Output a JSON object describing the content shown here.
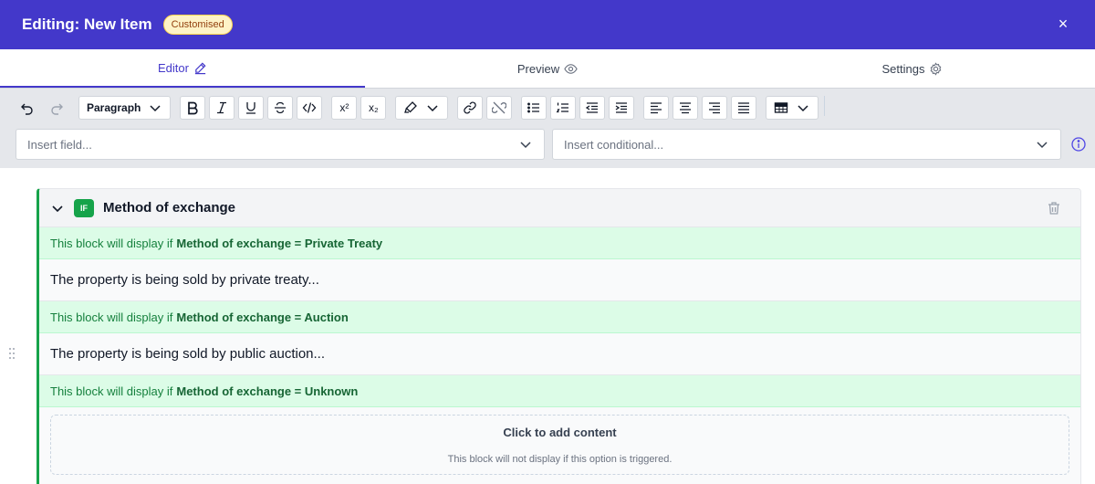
{
  "header": {
    "title": "Editing: New Item",
    "badge": "Customised",
    "close_label": "×"
  },
  "tabs": [
    {
      "label": "Editor",
      "icon": "pencil-icon",
      "active": true
    },
    {
      "label": "Preview",
      "icon": "eye-icon",
      "active": false
    },
    {
      "label": "Settings",
      "icon": "gear-icon",
      "active": false
    }
  ],
  "toolbar": {
    "paragraph_label": "Paragraph",
    "superscript_label": "x²",
    "subscript_label": "x₂",
    "insert_field_placeholder": "Insert field...",
    "insert_conditional_placeholder": "Insert conditional..."
  },
  "block": {
    "tag": "IF",
    "title": "Method of exchange",
    "conditions": [
      {
        "prefix": "This block will display if",
        "rule": "Method of exchange = Private Treaty",
        "content": "The property is being sold by private treaty..."
      },
      {
        "prefix": "This block will display if",
        "rule": "Method of exchange = Auction",
        "content": "The property is being sold by public auction..."
      },
      {
        "prefix": "This block will display if",
        "rule": "Method of exchange = Unknown",
        "add_title": "Click to add content",
        "add_subtitle": "This block will not display if this option is triggered."
      }
    ]
  },
  "colors": {
    "header_bg": "#4338ca",
    "accent": "#4338ca",
    "condition_bg": "#dcfce7",
    "condition_border": "#16a34a"
  }
}
